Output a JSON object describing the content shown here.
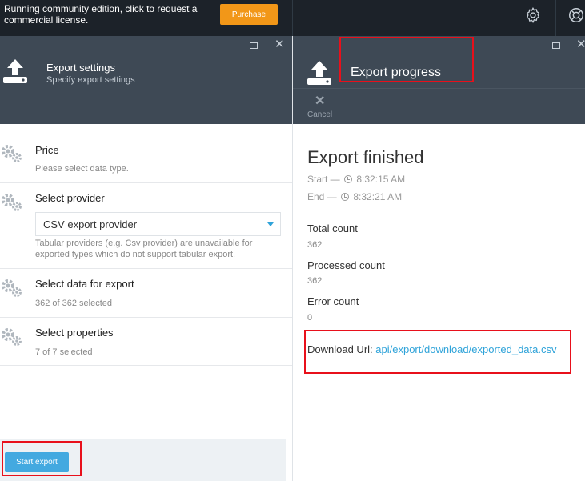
{
  "topbar": {
    "notice": "Running community edition, click to request a commercial license.",
    "purchase_label": "Purchase",
    "icons": [
      "gear-icon",
      "lifebuoy-icon"
    ]
  },
  "export_settings": {
    "title": "Export settings",
    "subtitle": "Specify export settings",
    "sections": [
      {
        "title": "Price",
        "description": "Please select data type."
      },
      {
        "title": "Select provider",
        "selected": "CSV export provider",
        "description": "Tabular providers (e.g. Csv provider) are unavailable for exported types which do not support tabular export."
      },
      {
        "title": "Select data for export",
        "description": "362 of 362 selected"
      },
      {
        "title": "Select properties",
        "description": "7 of 7 selected"
      }
    ],
    "start_label": "Start export"
  },
  "export_progress": {
    "title": "Export progress",
    "cancel_label": "Cancel",
    "status": "Export finished",
    "start_prefix": "Start —",
    "start_time": "8:32:15 AM",
    "end_prefix": "End —",
    "end_time": "8:32:21 AM",
    "stats": [
      {
        "label": "Total count",
        "value": "362"
      },
      {
        "label": "Processed count",
        "value": "362"
      },
      {
        "label": "Error count",
        "value": "0"
      }
    ],
    "download_label": "Download Url:",
    "download_url": "api/export/download/exported_data.csv"
  },
  "colors": {
    "topbar": "#1c2229",
    "blade_header": "#3e4955",
    "accent": "#2fa3d9",
    "purchase": "#f29718",
    "annotation": "#e8101b"
  }
}
